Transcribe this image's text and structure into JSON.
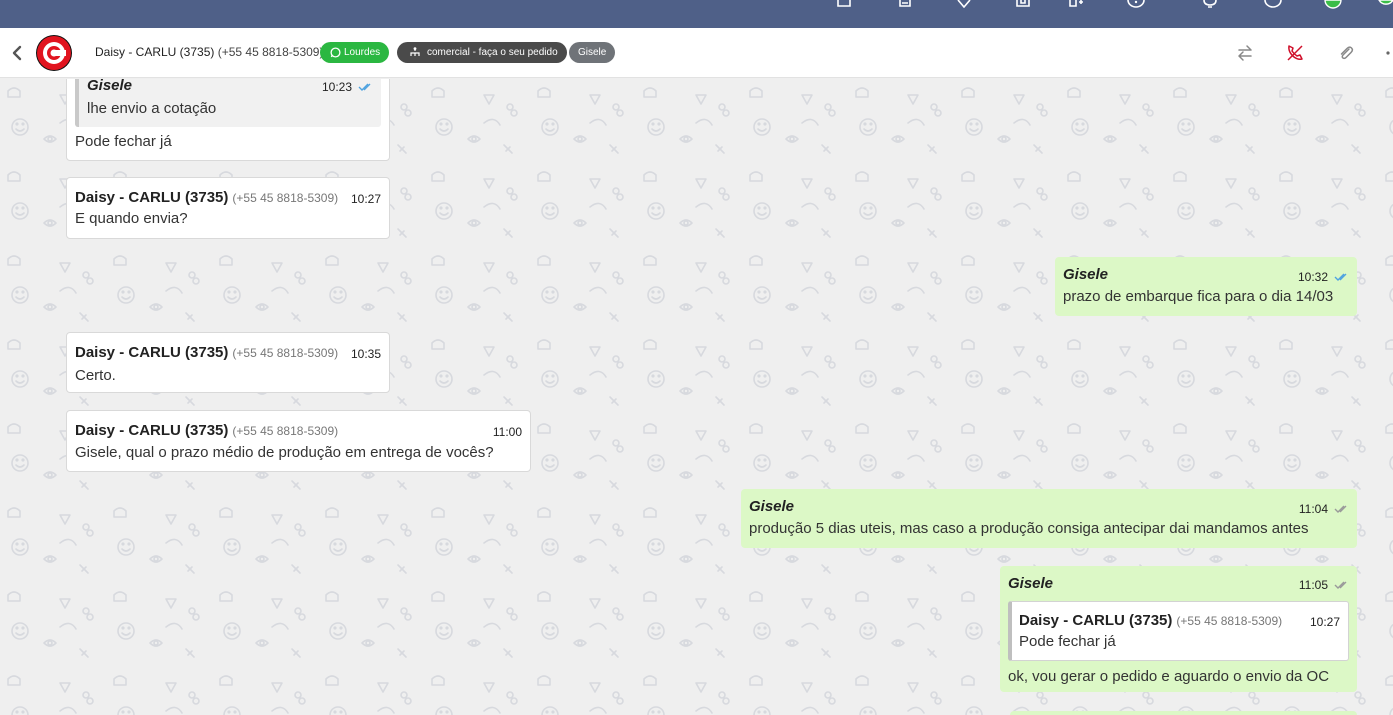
{
  "top_bar": {
    "icons": [
      "mail-icon",
      "clipboard-icon",
      "location-icon",
      "box-icon",
      "add-icon",
      "help-icon",
      "bell-icon",
      "info-icon",
      "status-icon"
    ]
  },
  "header": {
    "contact_name": "Daisy - CARLU (3735)",
    "contact_phone": "(+55 45 8818-5309)",
    "tags": {
      "whatsapp": "Lourdes",
      "department": "comercial - faça o seu pedido",
      "agent": "Gisele"
    },
    "colors": {
      "green_tag": "#2bb741",
      "dark_tag": "#4a4a4a",
      "gray_tag": "#6f7378",
      "call_icon": "#d0102b"
    }
  },
  "messages": [
    {
      "direction": "in",
      "quote": {
        "author": "Gisele",
        "time": "10:23",
        "text": "lhe envio a cotação"
      },
      "text": "Pode fechar já"
    },
    {
      "direction": "in",
      "author": "Daisy - CARLU (3735)",
      "phone": "(+55 45 8818-5309)",
      "time": "10:27",
      "text": "E quando envia?"
    },
    {
      "direction": "out",
      "author": "Gisele",
      "time": "10:32",
      "read": true,
      "text": "prazo de embarque fica para o dia 14/03"
    },
    {
      "direction": "in",
      "author": "Daisy - CARLU (3735)",
      "phone": "(+55 45 8818-5309)",
      "time": "10:35",
      "text": "Certo."
    },
    {
      "direction": "in",
      "author": "Daisy - CARLU (3735)",
      "phone": "(+55 45 8818-5309)",
      "time": "11:00",
      "text": "Gisele, qual o prazo médio de produção em entrega de vocês?"
    },
    {
      "direction": "out",
      "author": "Gisele",
      "time": "11:04",
      "read": false,
      "text": "produção 5 dias uteis, mas caso a produção consiga antecipar dai mandamos antes"
    },
    {
      "direction": "out",
      "author": "Gisele",
      "time": "11:05",
      "read": false,
      "quote": {
        "author": "Daisy - CARLU (3735)",
        "phone": "(+55 45 8818-5309)",
        "time": "10:27",
        "text": "Pode fechar já"
      },
      "text": "ok, vou gerar o pedido e aguardo o envio da OC"
    }
  ],
  "colors": {
    "incoming_bubble": "#ffffff",
    "outgoing_bubble": "#dcf8c6",
    "read_tick": "#4fa3e0",
    "unread_tick": "#9a9a9a",
    "top_bar": "#4f6088"
  }
}
